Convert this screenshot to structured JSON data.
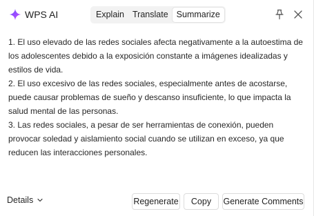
{
  "header": {
    "app_title": "WPS AI",
    "tabs": [
      {
        "label": "Explain",
        "active": false
      },
      {
        "label": "Translate",
        "active": false
      },
      {
        "label": "Summarize",
        "active": true
      }
    ],
    "icons": {
      "logo": "wps-ai-logo-icon",
      "pin": "pin-icon",
      "close": "close-icon"
    }
  },
  "content": {
    "items": [
      "1. El uso elevado de las redes sociales afecta negativamente a la autoestima de los adolescentes debido a la exposición constante a imágenes idealizadas y estilos de vida.",
      "2. El uso excesivo de las redes sociales, especialmente antes de acostarse, puede causar problemas de sueño y descanso insuficiente, lo que impacta la salud mental de las personas.",
      "3. Las redes sociales, a pesar de ser herramientas de conexión, pueden provocar soledad y aislamiento social cuando se utilizan en exceso, ya que reducen las interacciones personales."
    ]
  },
  "footer": {
    "details_label": "Details",
    "regenerate_label": "Regenerate",
    "copy_label": "Copy",
    "generate_comments_label": "Generate Comments"
  },
  "colors": {
    "logo_gradient_start": "#6a4cff",
    "logo_gradient_end": "#c84dff",
    "tab_bar_bg": "#f2f2f2",
    "button_border": "#dcdcdc"
  }
}
